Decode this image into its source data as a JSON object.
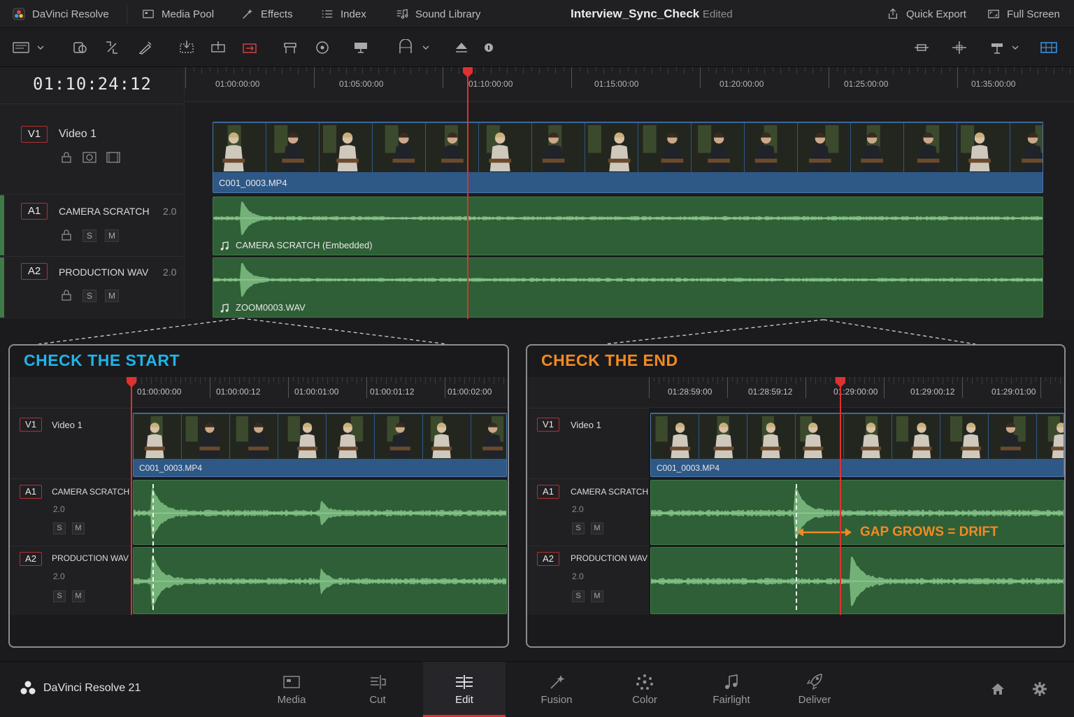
{
  "app": {
    "name": "DaVinci Resolve",
    "project_title": "Interview_Sync_Check",
    "status": "Edited"
  },
  "topbar": {
    "media_pool": "Media Pool",
    "effects": "Effects",
    "index": "Index",
    "sound_library": "Sound Library",
    "quick_export": "Quick Export",
    "full_screen": "Full Screen"
  },
  "timeline": {
    "timecode": "01:10:24:12",
    "ruler_labels": [
      "01:00:00:00",
      "01:05:00:00",
      "01:10:00:00",
      "01:15:00:00",
      "01:20:00:00",
      "01:25:00:00",
      "01:35:00:00"
    ],
    "tracks": {
      "v1": {
        "badge": "V1",
        "name": "Video 1"
      },
      "a1": {
        "badge": "A1",
        "name": "CAMERA SCRATCH",
        "channels": "2.0",
        "solo": "S",
        "mute": "M"
      },
      "a2": {
        "badge": "A2",
        "name": "PRODUCTION WAV",
        "channels": "2.0",
        "solo": "S",
        "mute": "M"
      }
    },
    "clips": {
      "video": "C001_0003.MP4",
      "audio1": "CAMERA SCRATCH (Embedded)",
      "audio2": "ZOOM0003.WAV"
    }
  },
  "panel_start": {
    "title": "CHECK THE START",
    "title_color": "#1fb4e8",
    "ruler_labels": [
      "01:00:00:00",
      "01:00:00:12",
      "01:00:01:00",
      "01:00:01:12",
      "01:00:02:00"
    ],
    "v1": {
      "badge": "V1",
      "name": "Video 1",
      "clip": "C001_0003.MP4"
    },
    "a1": {
      "badge": "A1",
      "name": "CAMERA SCRATCH",
      "channels": "2.0",
      "solo": "S",
      "mute": "M"
    },
    "a2": {
      "badge": "A2",
      "name": "PRODUCTION WAV",
      "channels": "2.0",
      "solo": "S",
      "mute": "M"
    }
  },
  "panel_end": {
    "title": "CHECK THE END",
    "title_color": "#f08a24",
    "ruler_labels": [
      "01:28:59:00",
      "01:28:59:12",
      "01:29:00:00",
      "01:29:00:12",
      "01:29:01:00"
    ],
    "v1": {
      "badge": "V1",
      "name": "Video 1",
      "clip": "C001_0003.MP4"
    },
    "a1": {
      "badge": "A1",
      "name": "CAMERA SCRATCH",
      "channels": "2.0",
      "solo": "S",
      "mute": "M"
    },
    "a2": {
      "badge": "A2",
      "name": "PRODUCTION WAV",
      "channels": "2.0",
      "solo": "S",
      "mute": "M"
    },
    "annotation": "GAP GROWS = DRIFT"
  },
  "bottombar": {
    "version": "DaVinci Resolve 21",
    "pages": [
      "Media",
      "Cut",
      "Edit",
      "Fusion",
      "Color",
      "Fairlight",
      "Deliver"
    ],
    "active_page": "Edit"
  },
  "colors": {
    "accent_red": "#e0302f",
    "video_clip": "#2e5886",
    "audio_clip": "#2f5f36",
    "waveform": "#7fbf84"
  }
}
